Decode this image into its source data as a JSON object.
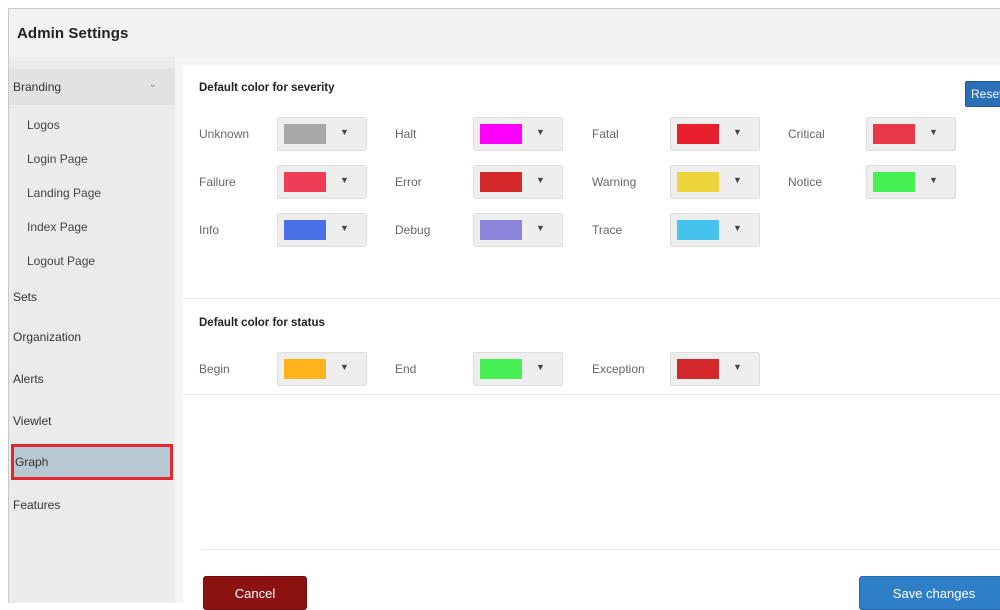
{
  "app": {
    "title": "Admin Settings"
  },
  "sidebar": {
    "branding": {
      "label": "Branding",
      "chevron": "⌄"
    },
    "branding_items": [
      "Logos",
      "Login Page",
      "Landing Page",
      "Index Page",
      "Logout Page"
    ],
    "items": [
      "Sets",
      "Organization",
      "Alerts",
      "Viewlet",
      "Graph",
      "Features"
    ],
    "active_item": "Graph"
  },
  "severity": {
    "title": "Default color for severity",
    "reset_label": "Reset",
    "fields": [
      {
        "label": "Unknown",
        "color": "#a9a9a9"
      },
      {
        "label": "Halt",
        "color": "#ff00ff"
      },
      {
        "label": "Fatal",
        "color": "#e8202e"
      },
      {
        "label": "Critical",
        "color": "#e8384a"
      },
      {
        "label": "Failure",
        "color": "#ee3d57"
      },
      {
        "label": "Error",
        "color": "#d3292b"
      },
      {
        "label": "Warning",
        "color": "#ecd43a"
      },
      {
        "label": "Notice",
        "color": "#46ef52"
      },
      {
        "label": "Info",
        "color": "#4a70e8"
      },
      {
        "label": "Debug",
        "color": "#8c84da"
      },
      {
        "label": "Trace",
        "color": "#46c3ec"
      }
    ]
  },
  "status": {
    "title": "Default color for status",
    "fields": [
      {
        "label": "Begin",
        "color": "#ffb21a"
      },
      {
        "label": "End",
        "color": "#46ef52"
      },
      {
        "label": "Exception",
        "color": "#d3292b"
      }
    ]
  },
  "buttons": {
    "cancel": "Cancel",
    "save": "Save changes"
  },
  "icons": {
    "dropdown": "caret-down-icon",
    "chevron": "chevron-down-icon"
  }
}
